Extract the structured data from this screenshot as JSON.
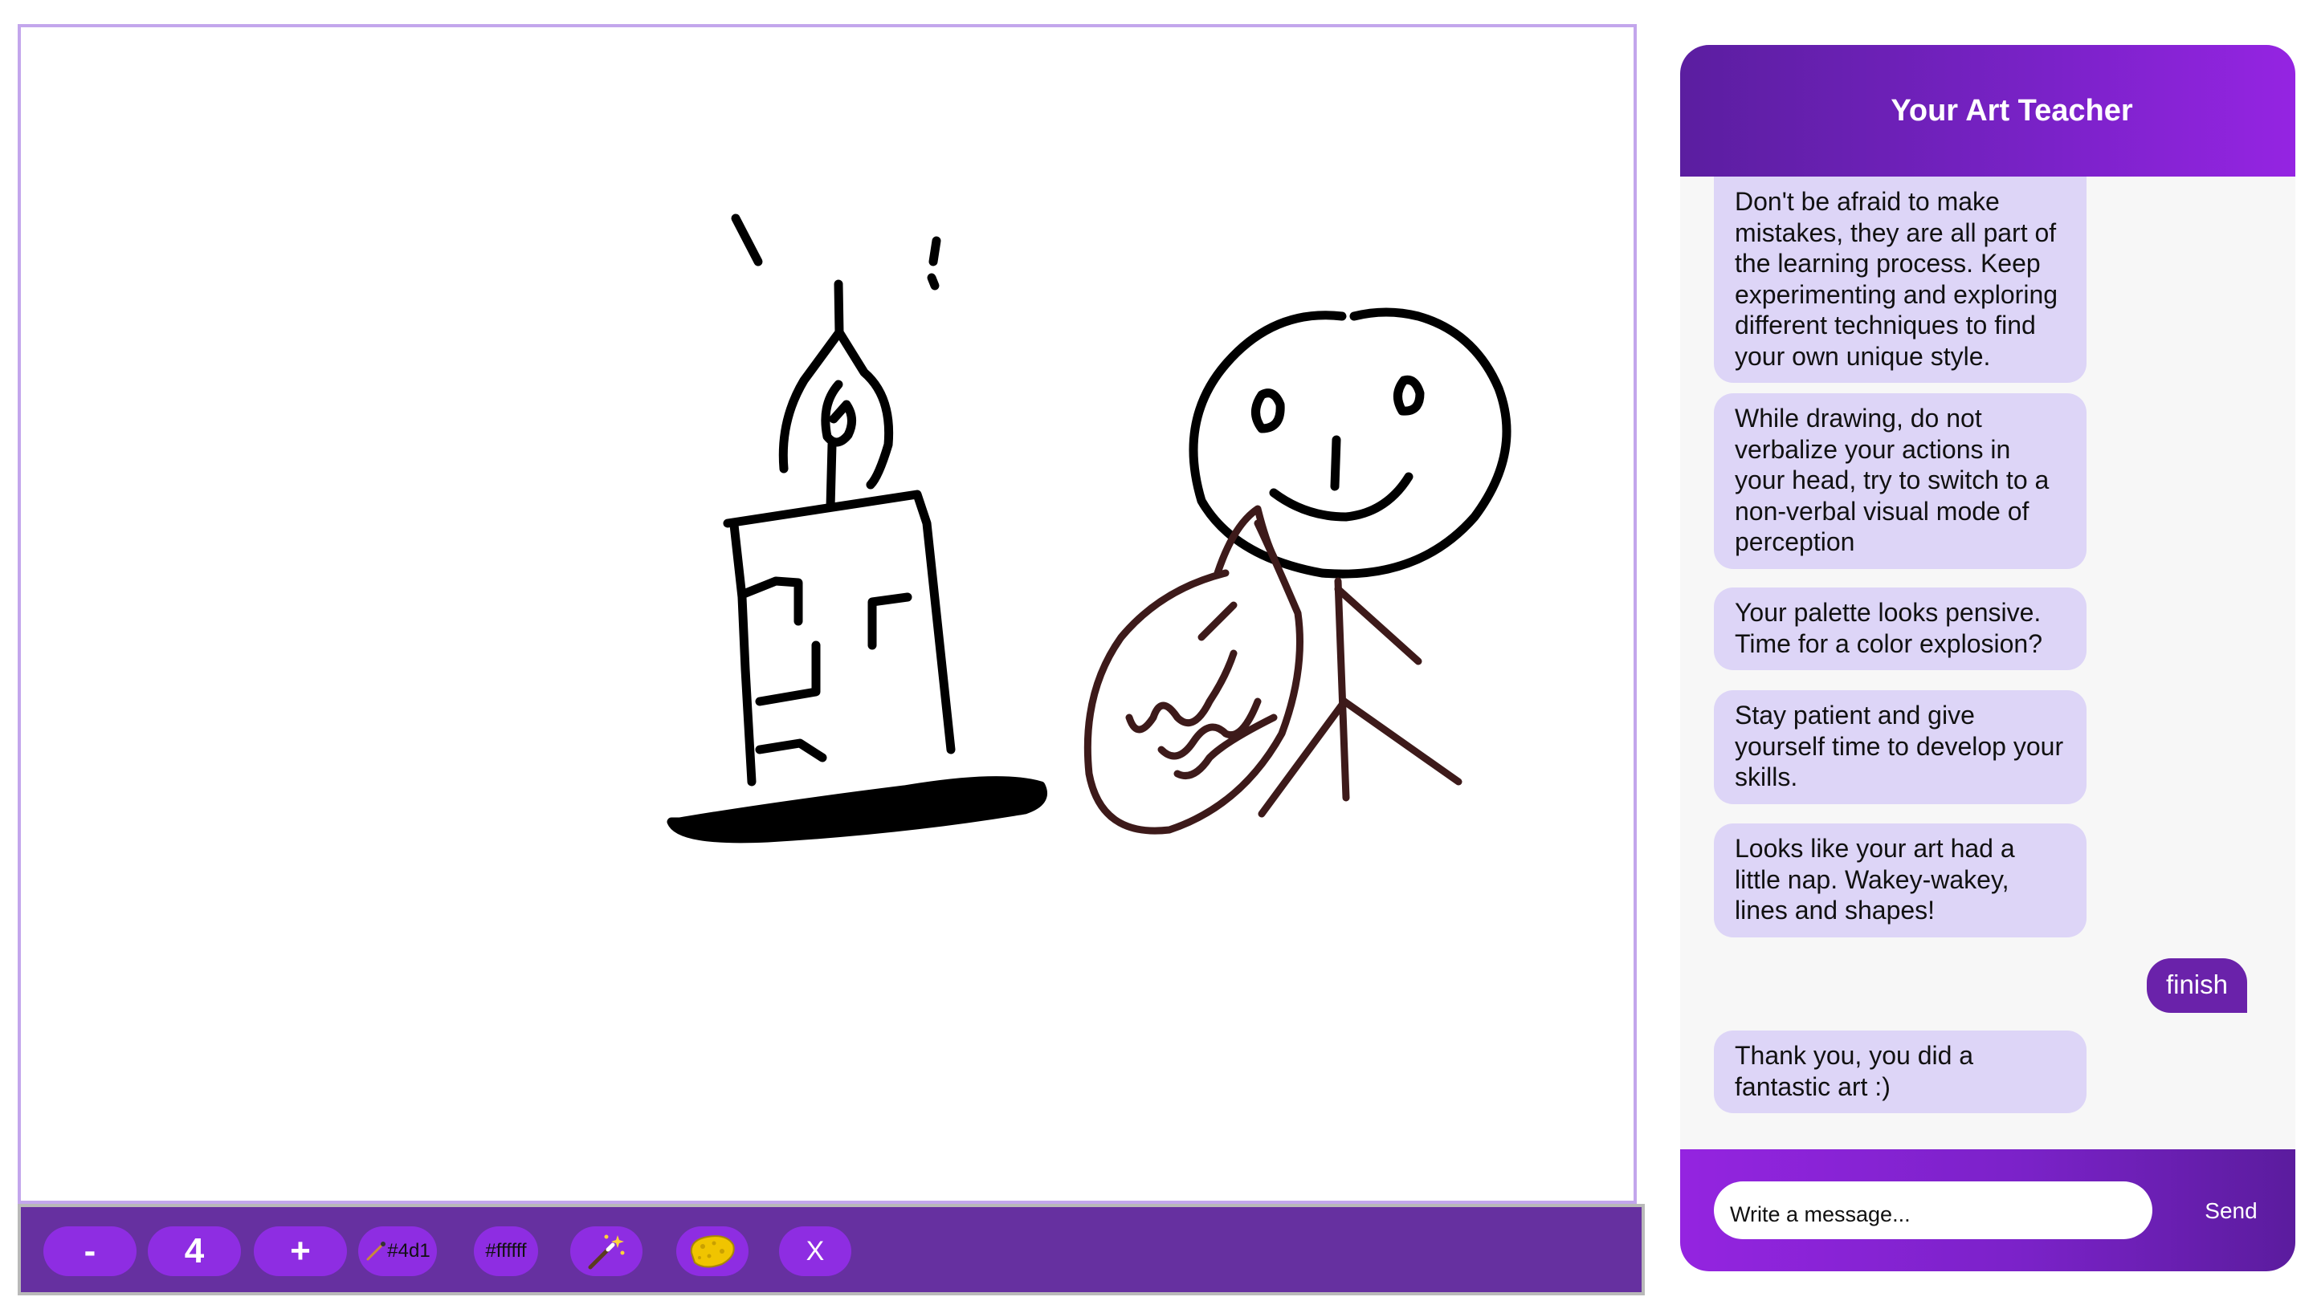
{
  "chat": {
    "title": "Your Art Teacher",
    "messages": [
      {
        "role": "assistant",
        "text": "Don't be afraid to make mistakes, they are all part of the learning process. Keep experimenting and exploring different techniques to find your own unique style."
      },
      {
        "role": "assistant",
        "text": "While drawing, do not verbalize your actions in your head, try to switch to a non-verbal visual mode of perception"
      },
      {
        "role": "assistant",
        "text": "Your palette looks pensive. Time for a color explosion?"
      },
      {
        "role": "assistant",
        "text": "Stay patient and give yourself time to develop your skills."
      },
      {
        "role": "assistant",
        "text": "Looks like your art had a little nap. Wakey-wakey, lines and shapes!"
      },
      {
        "role": "user",
        "text": "finish"
      },
      {
        "role": "assistant",
        "text": "Thank you, you did a fantastic art :)"
      }
    ],
    "input_placeholder": "Write a message...",
    "send_label": "Send"
  },
  "toolbar": {
    "decrease_label": "-",
    "brush_size": "4",
    "increase_label": "+",
    "primary_color": "#4d1",
    "secondary_color": "#ffffff",
    "magic_icon": "magic-wand-icon",
    "eraser_icon": "sponge-icon",
    "clear_label": "X"
  },
  "colors": {
    "accent": "#8e2de2",
    "toolbar_bg": "#6630a0",
    "canvas_border": "#c3a6ec",
    "assistant_bubble": "#ddd5f7",
    "user_bubble": "#6a22aa",
    "stroke_black": "#000000",
    "stroke_brown": "#3d1a1a"
  }
}
